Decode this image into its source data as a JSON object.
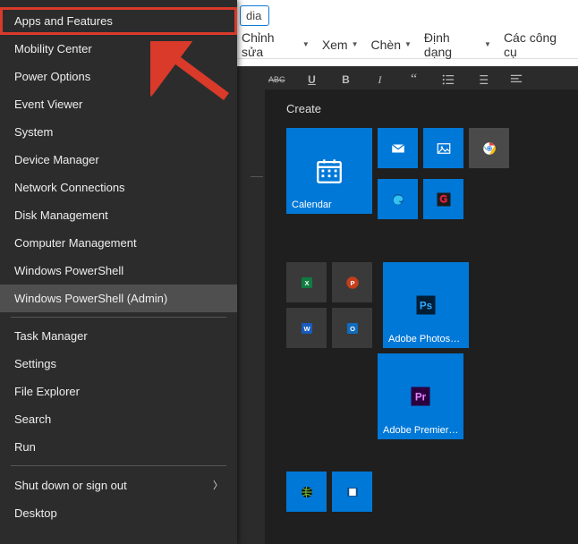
{
  "editor": {
    "media_button": "dia",
    "menu": {
      "edit": "Chỉnh sửa",
      "view": "Xem",
      "insert": "Chèn",
      "format": "Định dạng",
      "tools": "Các công cụ"
    }
  },
  "winx": {
    "items": [
      "Apps and Features",
      "Mobility Center",
      "Power Options",
      "Event Viewer",
      "System",
      "Device Manager",
      "Network Connections",
      "Disk Management",
      "Computer Management",
      "Windows PowerShell",
      "Windows PowerShell (Admin)"
    ],
    "items2": [
      "Task Manager",
      "Settings",
      "File Explorer",
      "Search",
      "Run"
    ],
    "shutdown": "Shut down or sign out",
    "desktop": "Desktop"
  },
  "start": {
    "group1_title": "Create",
    "tiles": {
      "calendar": "Calendar",
      "photoshop": "Adobe Photoshop C...",
      "premiere": "Adobe Premiere Pro..."
    }
  }
}
